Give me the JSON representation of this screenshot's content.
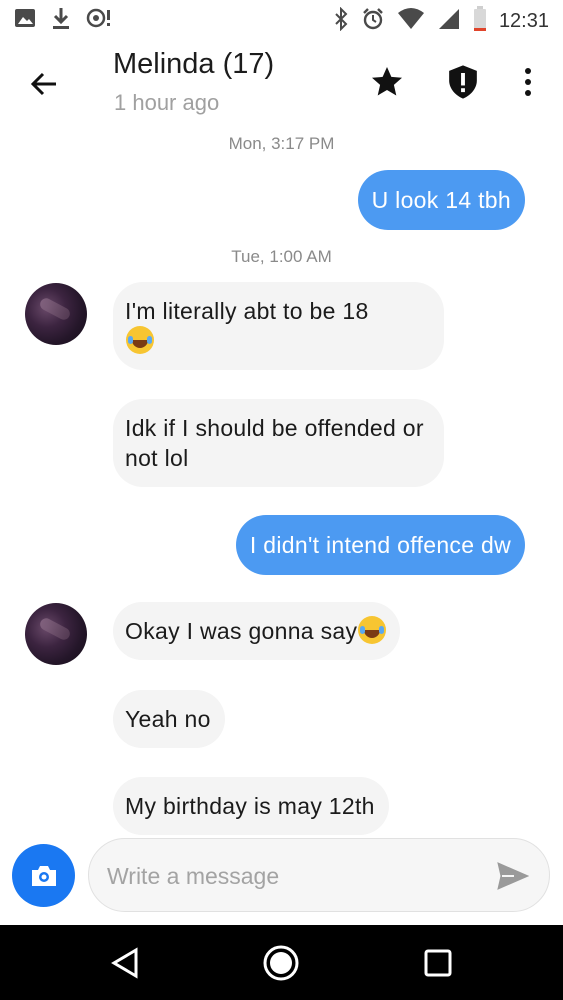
{
  "status_bar": {
    "time": "12:31",
    "left_icons": [
      "image-icon",
      "download-icon",
      "notification-icon"
    ],
    "right_icons": [
      "bluetooth-icon",
      "alarm-icon",
      "wifi-icon",
      "signal-icon",
      "battery-icon"
    ]
  },
  "header": {
    "name": "Melinda (17)",
    "last_seen": "1 hour ago",
    "icons": [
      "back-arrow-icon",
      "star-icon",
      "shield-alert-icon",
      "more-vert-icon"
    ]
  },
  "chat": {
    "timestamps": [
      "Mon, 3:17 PM",
      "Tue, 1:00 AM"
    ],
    "messages": [
      {
        "from": "me",
        "text": "U look 14 tbh"
      },
      {
        "from": "them",
        "text": "I'm literally abt to be 18",
        "emoji": "laughing-tears-emoji"
      },
      {
        "from": "them",
        "text": "Idk if I should be offended or not lol"
      },
      {
        "from": "me",
        "text": "I didn't intend offence dw"
      },
      {
        "from": "them",
        "text": "Okay I was gonna say",
        "emoji": "laughing-tears-emoji"
      },
      {
        "from": "them",
        "text": "Yeah no"
      },
      {
        "from": "them",
        "text": "My birthday is may 12th"
      }
    ]
  },
  "composer": {
    "placeholder": "Write a message",
    "value": "",
    "camera_icon": "camera-icon",
    "send_icon": "send-icon",
    "accent_color": "#1a78f2"
  },
  "colors": {
    "outgoing_bubble": "#4c9af2",
    "incoming_bubble": "#f4f4f4"
  },
  "nav_bar": {
    "icons": [
      "nav-back-icon",
      "nav-home-icon",
      "nav-recents-icon"
    ]
  }
}
